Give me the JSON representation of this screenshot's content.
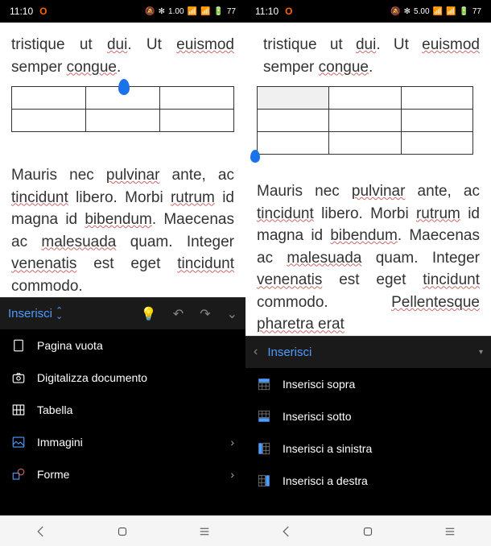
{
  "status": {
    "time": "11:10",
    "badge": "O",
    "right_text_1": "1.00",
    "right_text_2": "5.00",
    "battery": "77"
  },
  "doc": {
    "line1a": "tristique ut ",
    "line1b": "dui",
    "line1c": ". Ut ",
    "line1d": "euismod",
    "line2a": "semper ",
    "line2b": "congue",
    "line2c": ".",
    "body1a": "Mauris nec ",
    "body1b": "pulvinar",
    "body1c": " ante, ac ",
    "body1d": "tincidunt",
    "body1e": " libero. Morbi ",
    "body1f": "rutrum",
    "body1g": " id magna id ",
    "body1h": "bibendum",
    "body1i": ". Maecenas ac ",
    "body1j": "malesuada",
    "body1k": " quam. Integer ",
    "body1l": "venenatis",
    "body1m": " est eget ",
    "body1n": "tincidunt",
    "body1o": " commodo.",
    "body2_extra": "Pellentesque pharetra erat"
  },
  "toolbar": {
    "tab_label": "Inserisci"
  },
  "left_menu": {
    "blank_page": "Pagina vuota",
    "scan_doc": "Digitalizza documento",
    "table": "Tabella",
    "images": "Immagini",
    "shapes": "Forme"
  },
  "right_menu": {
    "insert_above": "Inserisci sopra",
    "insert_below": "Inserisci sotto",
    "insert_left": "Inserisci a sinistra",
    "insert_right": "Inserisci a destra"
  }
}
